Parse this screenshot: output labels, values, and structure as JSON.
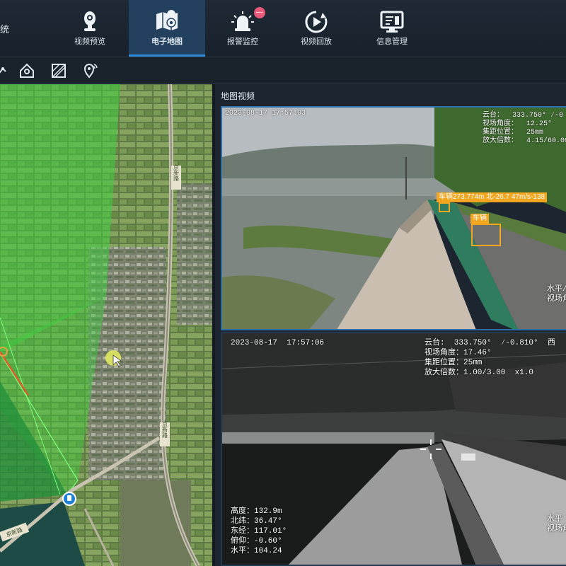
{
  "header": {
    "app_title_fragment": "统",
    "tabs": [
      {
        "label": "视频预览",
        "icon": "camera-icon"
      },
      {
        "label": "电子地图",
        "icon": "map-icon",
        "active": true
      },
      {
        "label": "报警监控",
        "icon": "alarm-siren-icon",
        "badge": "—"
      },
      {
        "label": "视频回放",
        "icon": "playback-icon"
      },
      {
        "label": "信息管理",
        "icon": "monitor-info-icon"
      }
    ]
  },
  "toolbar": {
    "tools": [
      "draw-line-icon",
      "location-house-icon",
      "area-select-icon",
      "location-signal-icon"
    ]
  },
  "map": {
    "road_labels": [
      "京新路",
      "京新路",
      "京新路"
    ]
  },
  "video_panel": {
    "title": "地图视频",
    "visible_camera": {
      "timestamp": "2023-08-17 17:57:03",
      "osd_right": [
        "云台：  333.750° ∕-0",
        "视场角度：  12.25°",
        "集距位置：  25mm",
        "放大倍数：  4.15/60.00"
      ],
      "osd_edge": [
        "水平/",
        "视场角"
      ],
      "detections": [
        {
          "label": "车辆273.774m 北-26.7 47m/s-138",
          "box_color": "#f2a51f"
        },
        {
          "label": "车辆",
          "box_color": "#f2a51f"
        }
      ]
    },
    "thermal_camera": {
      "timestamp": "2023-08-17  17:57:06",
      "osd_right": [
        "云台:  333.750°  ∕-0.810°  西",
        "视场角度：17.46°",
        "集距位置：25mm",
        "放大倍数：1.00/3.00  x1.0"
      ],
      "osd_left": [
        "高度：132.9m",
        "北纬：36.47°",
        "东经：117.01°",
        "俯仰：-0.60°",
        "水平：104.24"
      ],
      "osd_edge": [
        "水平",
        "视场角"
      ]
    }
  },
  "colors": {
    "nav_active": "#23405f",
    "accent_blue": "#2e8ad8",
    "badge": "#e8587a",
    "detection": "#f2a51f",
    "coverage_green": "#3fcf3f"
  }
}
